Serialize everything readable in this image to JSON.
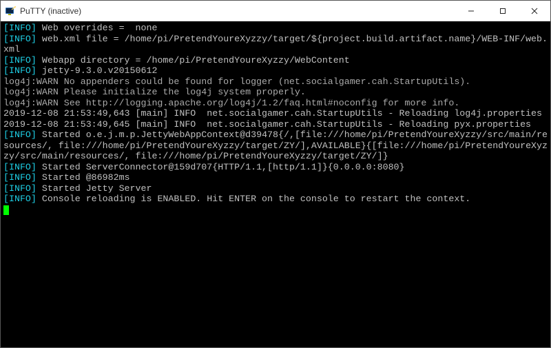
{
  "window": {
    "title": "PuTTY (inactive)"
  },
  "icons": {
    "app": "putty-icon",
    "min": "—",
    "max": "☐",
    "close": "✕"
  },
  "log": {
    "l0_pref": "[INFO]",
    "l0": " Web overrides =  none",
    "l1_pref": "[INFO]",
    "l1": " web.xml file = /home/pi/PretendYoureXyzzy/target/${project.build.artifact.name}/WEB-INF/web.xml",
    "l2_pref": "[INFO]",
    "l2": " Webapp directory = /home/pi/PretendYoureXyzzy/WebContent",
    "l3_pref": "[INFO]",
    "l3": " jetty-9.3.0.v20150612",
    "l4": "log4j:WARN No appenders could be found for logger (net.socialgamer.cah.StartupUtils).",
    "l5": "log4j:WARN Please initialize the log4j system properly.",
    "l6": "log4j:WARN See http://logging.apache.org/log4j/1.2/faq.html#noconfig for more info.",
    "l7": "2019-12-08 21:53:49,643 [main] INFO  net.socialgamer.cah.StartupUtils - Reloading log4j.properties",
    "l8": "2019-12-08 21:53:49,645 [main] INFO  net.socialgamer.cah.StartupUtils - Reloading pyx.properties",
    "l9_pref": "[INFO]",
    "l9": " Started o.e.j.m.p.JettyWebAppContext@d39478{/,[file:///home/pi/PretendYoureXyzzy/src/main/resources/, file:///home/pi/PretendYoureXyzzy/target/ZY/],AVAILABLE}{[file:///home/pi/PretendYoureXyzzy/src/main/resources/, file:///home/pi/PretendYoureXyzzy/target/ZY/]}",
    "l10_pref": "[INFO]",
    "l10": " Started ServerConnector@159d707{HTTP/1.1,[http/1.1]}{0.0.0.0:8080}",
    "l11_pref": "[INFO]",
    "l11": " Started @86982ms",
    "l12_pref": "[INFO]",
    "l12": " Started Jetty Server",
    "l13_pref": "[INFO]",
    "l13": " Console reloading is ENABLED. Hit ENTER on the console to restart the context."
  }
}
